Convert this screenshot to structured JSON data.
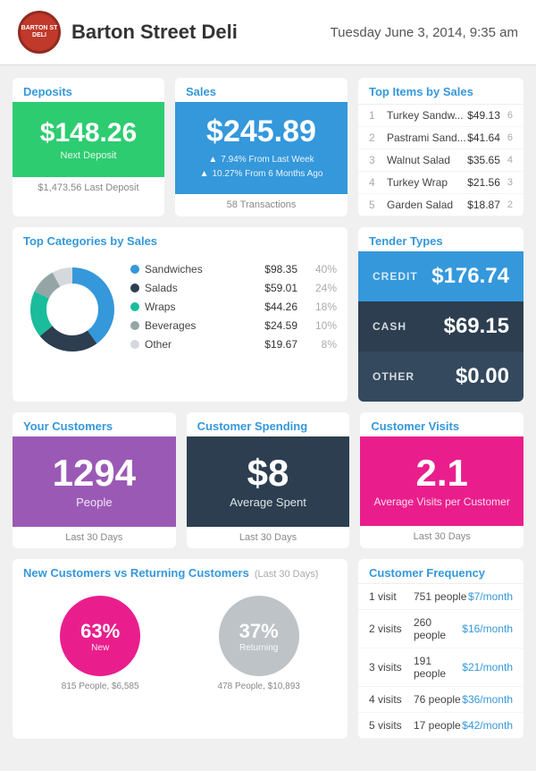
{
  "header": {
    "logo_text": "BARTON ST DELI",
    "deli_name": "Barton Street Deli",
    "date_time": "Tuesday June 3, 2014, 9:35 am"
  },
  "deposits": {
    "title": "Deposits",
    "amount": "$148.26",
    "label": "Next Deposit",
    "footer": "$1,473.56 Last Deposit"
  },
  "sales": {
    "title": "Sales",
    "amount": "$245.89",
    "stat1": "7.94% From Last Week",
    "stat2": "10.27% From 6 Months Ago",
    "footer": "58 Transactions"
  },
  "top_items": {
    "title": "Top Items by Sales",
    "items": [
      {
        "num": "1",
        "name": "Turkey Sandw...",
        "price": "$49.13",
        "count": "6"
      },
      {
        "num": "2",
        "name": "Pastrami Sand...",
        "price": "$41.64",
        "count": "6"
      },
      {
        "num": "3",
        "name": "Walnut Salad",
        "price": "$35.65",
        "count": "4"
      },
      {
        "num": "4",
        "name": "Turkey Wrap",
        "price": "$21.56",
        "count": "3"
      },
      {
        "num": "5",
        "name": "Garden Salad",
        "price": "$18.87",
        "count": "2"
      }
    ]
  },
  "categories": {
    "title": "Top Categories by Sales",
    "items": [
      {
        "name": "Sandwiches",
        "amount": "$98.35",
        "pct": "40%",
        "color": "#3498db"
      },
      {
        "name": "Salads",
        "amount": "$59.01",
        "pct": "24%",
        "color": "#2c3e50"
      },
      {
        "name": "Wraps",
        "amount": "$44.26",
        "pct": "18%",
        "color": "#1abc9c"
      },
      {
        "name": "Beverages",
        "amount": "$24.59",
        "pct": "10%",
        "color": "#95a5a6"
      },
      {
        "name": "Other",
        "amount": "$19.67",
        "pct": "8%",
        "color": "#d5d8dc"
      }
    ]
  },
  "tender": {
    "title": "Tender Types",
    "rows": [
      {
        "label": "CREDIT",
        "amount": "$176.74",
        "type": "credit"
      },
      {
        "label": "CASH",
        "amount": "$69.15",
        "type": "cash"
      },
      {
        "label": "OTHER",
        "amount": "$0.00",
        "type": "other"
      }
    ]
  },
  "your_customers": {
    "title": "Your Customers",
    "number": "1294",
    "sub": "People",
    "footer": "Last 30 Days"
  },
  "spending": {
    "title": "Customer Spending",
    "number": "$8",
    "sub": "Average Spent",
    "footer": "Last 30 Days"
  },
  "visits": {
    "title": "Customer Visits",
    "number": "2.1",
    "sub": "Average Visits per Customer",
    "footer": "Last 30 Days"
  },
  "new_returning": {
    "title": "New Customers vs Returning Customers",
    "subtitle": "(Last 30 Days)",
    "new_pct": "63%",
    "new_label": "New",
    "new_footer": "815 People, $6,585",
    "returning_pct": "37%",
    "returning_label": "Returning",
    "returning_footer": "478 People, $10,893"
  },
  "frequency": {
    "title": "Customer Frequency",
    "rows": [
      {
        "visits": "1 visit",
        "people": "751 people",
        "amount": "$7/month"
      },
      {
        "visits": "2 visits",
        "people": "260 people",
        "amount": "$16/month"
      },
      {
        "visits": "3 visits",
        "people": "191 people",
        "amount": "$21/month"
      },
      {
        "visits": "4 visits",
        "people": "76 people",
        "amount": "$36/month"
      },
      {
        "visits": "5 visits",
        "people": "17 people",
        "amount": "$42/month"
      }
    ]
  }
}
